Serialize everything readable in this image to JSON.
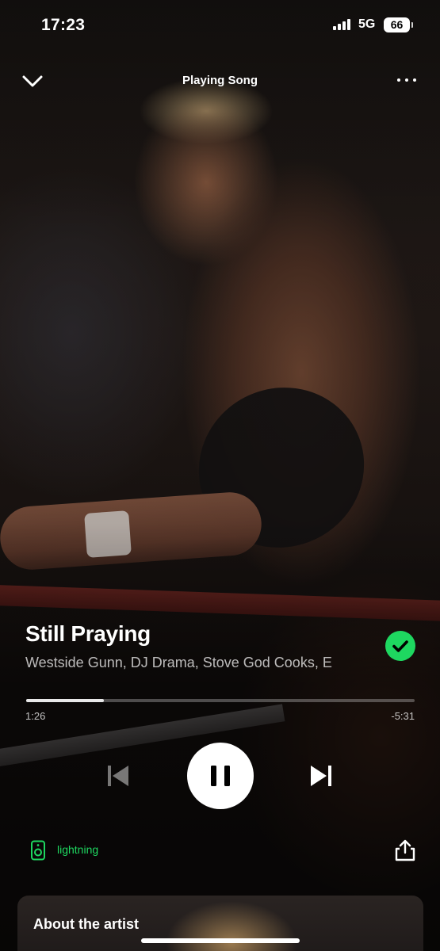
{
  "status_bar": {
    "time": "17:23",
    "network": "5G",
    "battery": "66"
  },
  "header": {
    "title": "Playing Song",
    "collapse_icon": "chevron-down-icon",
    "more_icon": "more-horizontal-icon"
  },
  "track": {
    "title": "Still Praying",
    "artists": "Westside Gunn, DJ Drama, Stove God Cooks, E",
    "liked": true
  },
  "progress": {
    "elapsed": "1:26",
    "remaining": "-5:31",
    "fraction": 0.2
  },
  "controls": {
    "previous_icon": "skip-previous-icon",
    "play_pause_icon": "pause-icon",
    "next_icon": "skip-next-icon"
  },
  "device": {
    "name": "lightning",
    "icon": "speaker-icon"
  },
  "share": {
    "icon": "share-icon"
  },
  "about_card": {
    "title": "About the artist"
  },
  "colors": {
    "accent": "#1ed760",
    "background": "#0d0b0a",
    "text": "#ffffff"
  }
}
